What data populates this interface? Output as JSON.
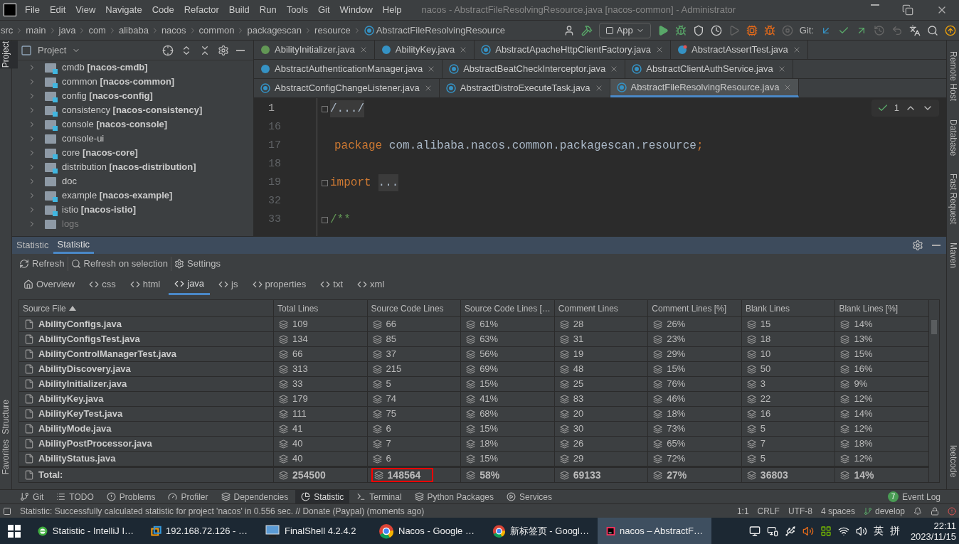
{
  "window": {
    "title": "nacos - AbstractFileResolvingResource.java [nacos-common] - Administrator"
  },
  "menu": [
    "File",
    "Edit",
    "View",
    "Navigate",
    "Code",
    "Refactor",
    "Build",
    "Run",
    "Tools",
    "Git",
    "Window",
    "Help"
  ],
  "breadcrumb": [
    "src",
    "main",
    "java",
    "com",
    "alibaba",
    "nacos",
    "common",
    "packagescan",
    "resource",
    "AbstractFileResolvingResource"
  ],
  "toolbar": {
    "run_config": "App",
    "git_label": "Git:"
  },
  "left_stripe": [
    {
      "label": "Project",
      "selected": true
    },
    {
      "label": "Structure",
      "selected": false
    },
    {
      "label": "Favorites",
      "selected": false
    }
  ],
  "right_stripe": [
    "Remote Host",
    "Database",
    "Fast Request",
    "Maven",
    "leetcode"
  ],
  "project_panel": {
    "title": "Project",
    "items": [
      {
        "label": "cmdb **[nacos-cmdb]**",
        "module": true,
        "excluded": false
      },
      {
        "label": "common **[nacos-common]**",
        "module": true,
        "excluded": false
      },
      {
        "label": "config **[nacos-config]**",
        "module": true,
        "excluded": false
      },
      {
        "label": "consistency **[nacos-consistency]**",
        "module": true,
        "excluded": false
      },
      {
        "label": "console **[nacos-console]**",
        "module": true,
        "excluded": false
      },
      {
        "label": "console-ui",
        "module": false,
        "excluded": false
      },
      {
        "label": "core **[nacos-core]**",
        "module": true,
        "excluded": false
      },
      {
        "label": "distribution **[nacos-distribution]**",
        "module": true,
        "excluded": false
      },
      {
        "label": "doc",
        "module": false,
        "excluded": false
      },
      {
        "label": "example **[nacos-example]**",
        "module": true,
        "excluded": false
      },
      {
        "label": "istio **[nacos-istio]**",
        "module": true,
        "excluded": false
      },
      {
        "label": "logs",
        "module": false,
        "excluded": true
      }
    ]
  },
  "editor_tabs": [
    [
      {
        "label": "AbilityInitializer.java",
        "kind": "interface",
        "selected": false
      },
      {
        "label": "AbilityKey.java",
        "kind": "enum",
        "selected": false
      },
      {
        "label": "AbstractApacheHttpClientFactory.java",
        "kind": "abstract",
        "selected": false
      },
      {
        "label": "AbstractAssertTest.java",
        "kind": "test",
        "selected": false
      }
    ],
    [
      {
        "label": "AbstractAuthenticationManager.java",
        "kind": "class",
        "selected": false
      },
      {
        "label": "AbstractBeatCheckInterceptor.java",
        "kind": "abstract",
        "selected": false
      },
      {
        "label": "AbstractClientAuthService.java",
        "kind": "abstract",
        "selected": false
      }
    ],
    [
      {
        "label": "AbstractConfigChangeListener.java",
        "kind": "abstract",
        "selected": false
      },
      {
        "label": "AbstractDistroExecuteTask.java",
        "kind": "abstract",
        "selected": false
      },
      {
        "label": "AbstractFileResolvingResource.java",
        "kind": "abstract",
        "selected": true
      }
    ]
  ],
  "editor": {
    "inspection_count": "1",
    "lines": [
      {
        "number": "1",
        "kind": "fold",
        "text": "/.../",
        "current": true
      },
      {
        "number": "16",
        "kind": "blank",
        "current": false
      },
      {
        "number": "17",
        "kind": "statement",
        "keyword": "package",
        "text": "com.alibaba.nacos.common.packagescan.resource",
        "punct": ";",
        "current": false
      },
      {
        "number": "18",
        "kind": "blank",
        "current": false
      },
      {
        "number": "19",
        "kind": "folded",
        "keyword": "import",
        "text": "...",
        "current": false
      },
      {
        "number": "32",
        "kind": "blank",
        "current": false
      },
      {
        "number": "33",
        "kind": "comment",
        "text": "/**",
        "current": false
      }
    ]
  },
  "statistic": {
    "tabs": [
      {
        "label": "Statistic",
        "selected": false
      },
      {
        "label": "Statistic",
        "selected": true
      }
    ],
    "actions": [
      {
        "label": "Refresh",
        "kind": "refresh"
      },
      {
        "label": "Refresh on selection",
        "kind": "search"
      },
      {
        "label": "Settings",
        "kind": "settings"
      }
    ],
    "file_types": [
      {
        "label": "Overview",
        "kind": "home",
        "selected": false
      },
      {
        "label": "css",
        "kind": "code",
        "selected": false
      },
      {
        "label": "html",
        "kind": "code",
        "selected": false
      },
      {
        "label": "java",
        "kind": "code",
        "selected": true
      },
      {
        "label": "js",
        "kind": "code",
        "selected": false
      },
      {
        "label": "properties",
        "kind": "code",
        "selected": false
      },
      {
        "label": "txt",
        "kind": "code",
        "selected": false
      },
      {
        "label": "xml",
        "kind": "code",
        "selected": false
      }
    ],
    "table": {
      "columns": [
        {
          "label": "Source File",
          "sorted": true
        },
        {
          "label": "Total Lines",
          "sorted": false
        },
        {
          "label": "Source Code Lines",
          "sorted": false
        },
        {
          "label": "Source Code Lines […",
          "sorted": false
        },
        {
          "label": "Comment Lines",
          "sorted": false
        },
        {
          "label": "Comment Lines [%]",
          "sorted": false
        },
        {
          "label": "Blank Lines",
          "sorted": false
        },
        {
          "label": "Blank Lines [%]",
          "sorted": false
        }
      ],
      "rows": [
        [
          "AbilityConfigs.java",
          "109",
          "66",
          "61%",
          "28",
          "26%",
          "15",
          "14%"
        ],
        [
          "AbilityConfigsTest.java",
          "134",
          "85",
          "63%",
          "31",
          "23%",
          "18",
          "13%"
        ],
        [
          "AbilityControlManagerTest.java",
          "66",
          "37",
          "56%",
          "19",
          "29%",
          "10",
          "15%"
        ],
        [
          "AbilityDiscovery.java",
          "313",
          "215",
          "69%",
          "48",
          "15%",
          "50",
          "16%"
        ],
        [
          "AbilityInitializer.java",
          "33",
          "5",
          "15%",
          "25",
          "76%",
          "3",
          "9%"
        ],
        [
          "AbilityKey.java",
          "179",
          "74",
          "41%",
          "83",
          "46%",
          "22",
          "12%"
        ],
        [
          "AbilityKeyTest.java",
          "111",
          "75",
          "68%",
          "20",
          "18%",
          "16",
          "14%"
        ],
        [
          "AbilityMode.java",
          "41",
          "6",
          "15%",
          "30",
          "73%",
          "5",
          "12%"
        ],
        [
          "AbilityPostProcessor.java",
          "40",
          "7",
          "18%",
          "26",
          "65%",
          "7",
          "18%"
        ],
        [
          "AbilityStatus.java",
          "40",
          "6",
          "15%",
          "29",
          "72%",
          "5",
          "12%"
        ]
      ],
      "totals": {
        "label": "Total:",
        "values": [
          {
            "text": "254500",
            "highlighted": false
          },
          {
            "text": "148564",
            "highlighted": true
          },
          {
            "text": "58%",
            "highlighted": false
          },
          {
            "text": "69133",
            "highlighted": false
          },
          {
            "text": "27%",
            "highlighted": false
          },
          {
            "text": "36803",
            "highlighted": false
          },
          {
            "text": "14%",
            "highlighted": false
          }
        ]
      }
    }
  },
  "tool_windows": [
    {
      "label": "Git",
      "kind": "git",
      "selected": false
    },
    {
      "label": "TODO",
      "kind": "list",
      "selected": false
    },
    {
      "label": "Problems",
      "kind": "alert",
      "selected": false
    },
    {
      "label": "Profiler",
      "kind": "gauge",
      "selected": false
    },
    {
      "label": "Dependencies",
      "kind": "layers",
      "selected": false
    },
    {
      "label": "Statistic",
      "kind": "pie",
      "selected": true
    },
    {
      "label": "Terminal",
      "kind": "terminal",
      "selected": false
    },
    {
      "label": "Python Packages",
      "kind": "layers",
      "selected": false
    },
    {
      "label": "Services",
      "kind": "play",
      "selected": false
    }
  ],
  "event_log": {
    "count": "7",
    "label": "Event Log"
  },
  "status_bar": {
    "message": "Statistic: Successfully calculated statistic for project 'nacos' in 0.556 sec. // Donate (Paypal) (moments ago)",
    "items": [
      "1:1",
      "CRLF",
      "UTF-8",
      "4 spaces"
    ],
    "branch": "develop"
  },
  "taskbar": {
    "apps": [
      {
        "label": "Statistic - IntelliJ I…",
        "kind": "ie",
        "selected": false
      },
      {
        "label": "192.168.72.126 - …",
        "kind": "vm",
        "selected": false
      },
      {
        "label": "FinalShell 4.2.4.2",
        "kind": "monitor",
        "selected": false
      },
      {
        "label": "Nacos - Google …",
        "kind": "chrome",
        "selected": false
      },
      {
        "label": "新标签页 - Googl…",
        "kind": "chrome",
        "selected": false
      },
      {
        "label": "nacos – AbstractF…",
        "kind": "idea",
        "selected": true
      }
    ],
    "tray": [
      "英",
      "拼"
    ],
    "time": "22:11",
    "date": "2023/11/15"
  }
}
